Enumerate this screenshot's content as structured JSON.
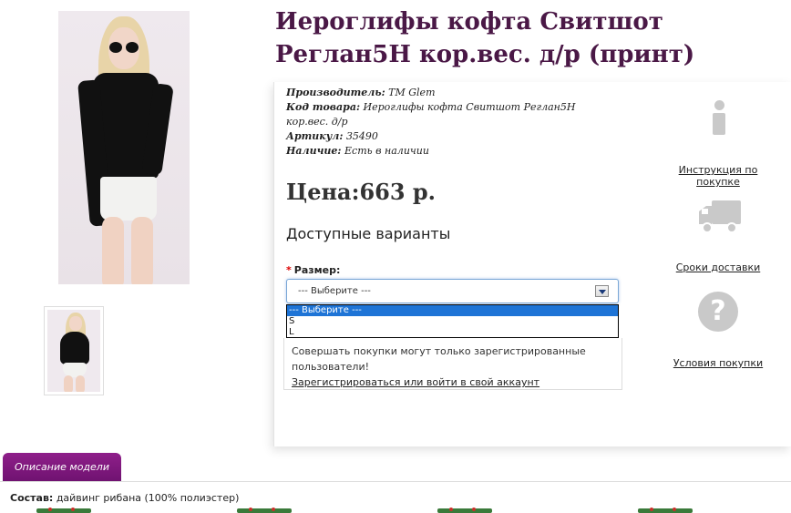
{
  "product": {
    "title": "Иероглифы кофта Свитшот Реглан5Н кор.вес. д/р (принт)",
    "manufacturer_label": "Производитель:",
    "manufacturer": "TM Glem",
    "code_label": "Код товара:",
    "code": "Иероглифы кофта Свитшот Реглан5Н кор.вес. д/р",
    "sku_label": "Артикул:",
    "sku": "35490",
    "stock_label": "Наличие:",
    "stock": "Есть в наличии",
    "price": "Цена:663 р."
  },
  "options": {
    "heading": "Доступные варианты",
    "size_label": "Размер:",
    "selected": "--- Выберите ---",
    "dropdown": [
      "--- Выберите ---",
      "S",
      "L"
    ]
  },
  "notice": {
    "text": "Совершать покупки могут только зарегистрированные пользователи!",
    "link": "Зарегистрироваться или войти в свой аккаунт"
  },
  "side_links": {
    "instructions": "Инструкция по покупке",
    "delivery": "Сроки доставки",
    "terms": "Условия покупки"
  },
  "tabs": {
    "description": "Описание модели"
  },
  "composition": {
    "label": "Состав:",
    "value": "дайвинг рибана (100% полиэстер)"
  },
  "icons": {
    "info": "info-icon",
    "truck": "truck-icon",
    "help": "question-icon"
  }
}
